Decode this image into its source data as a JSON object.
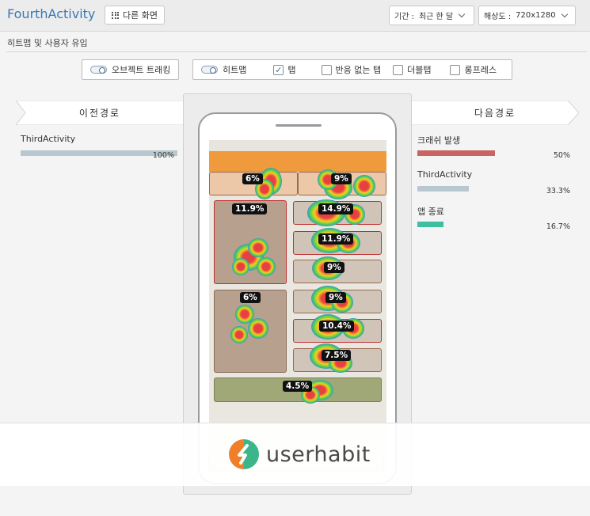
{
  "header": {
    "title": "FourthActivity",
    "other_screen_label": "다른 화면",
    "period_label": "기간 :",
    "period_value": "최근 한 달",
    "resolution_label": "해상도 :",
    "resolution_value": "720x1280"
  },
  "section_title": "히트맵 및 사용자 유입",
  "toolbar": {
    "object_tracking": "오브젝트 트래킹",
    "heatmap": "히트맵",
    "tap": "탭",
    "tap_checked": true,
    "no_response_tap": "반응 없는 탭",
    "double_tap": "더블탭",
    "long_press": "롱프레스"
  },
  "previous_path": {
    "title": "이전경로",
    "items": [
      {
        "label": "ThirdActivity",
        "percent": "100%",
        "ratio": 1.0,
        "color": "#b8c8d0"
      }
    ]
  },
  "next_path": {
    "title": "다음경로",
    "items": [
      {
        "label": "크래쉬 발생",
        "percent": "50%",
        "ratio": 0.5,
        "color": "#c86464"
      },
      {
        "label": "ThirdActivity",
        "percent": "33.3%",
        "ratio": 0.333,
        "color": "#b8c8d0"
      },
      {
        "label": "앱 종료",
        "percent": "16.7%",
        "ratio": 0.167,
        "color": "#3ec0a0"
      }
    ]
  },
  "heatmap_labels": {
    "top_left": "6%",
    "top_right": "9%",
    "big_left_top": "11.9%",
    "right_1": "14.9%",
    "right_2": "11.9%",
    "right_3": "9%",
    "big_left_bottom": "6%",
    "right_4": "9%",
    "right_5": "10.4%",
    "right_6": "7.5%",
    "bottom_bar": "4.5%"
  },
  "brand": {
    "name": "userhabit"
  },
  "colors": {
    "title_blue": "#3a78b8",
    "accent_orange": "#f09a3e"
  }
}
